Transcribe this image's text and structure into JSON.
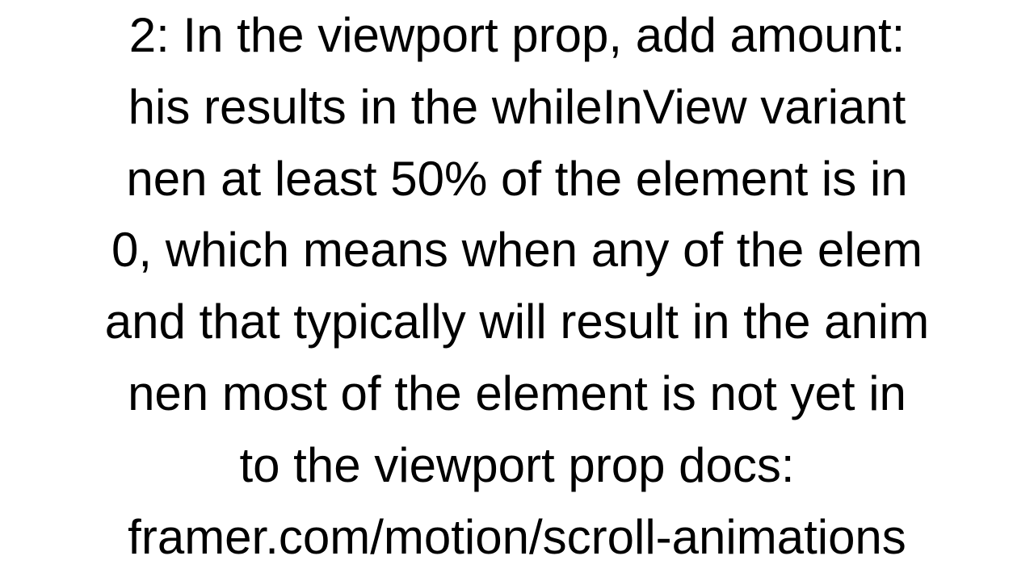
{
  "lines": [
    "2: In the viewport prop, add amount:",
    "his results in the whileInView variant",
    "nen at least 50% of the element is in",
    "0, which means when any of the elem",
    "and that typically will result in the anim",
    "nen most of the element is not yet in",
    "to the viewport prop docs:",
    "framer.com/motion/scroll-animations"
  ]
}
